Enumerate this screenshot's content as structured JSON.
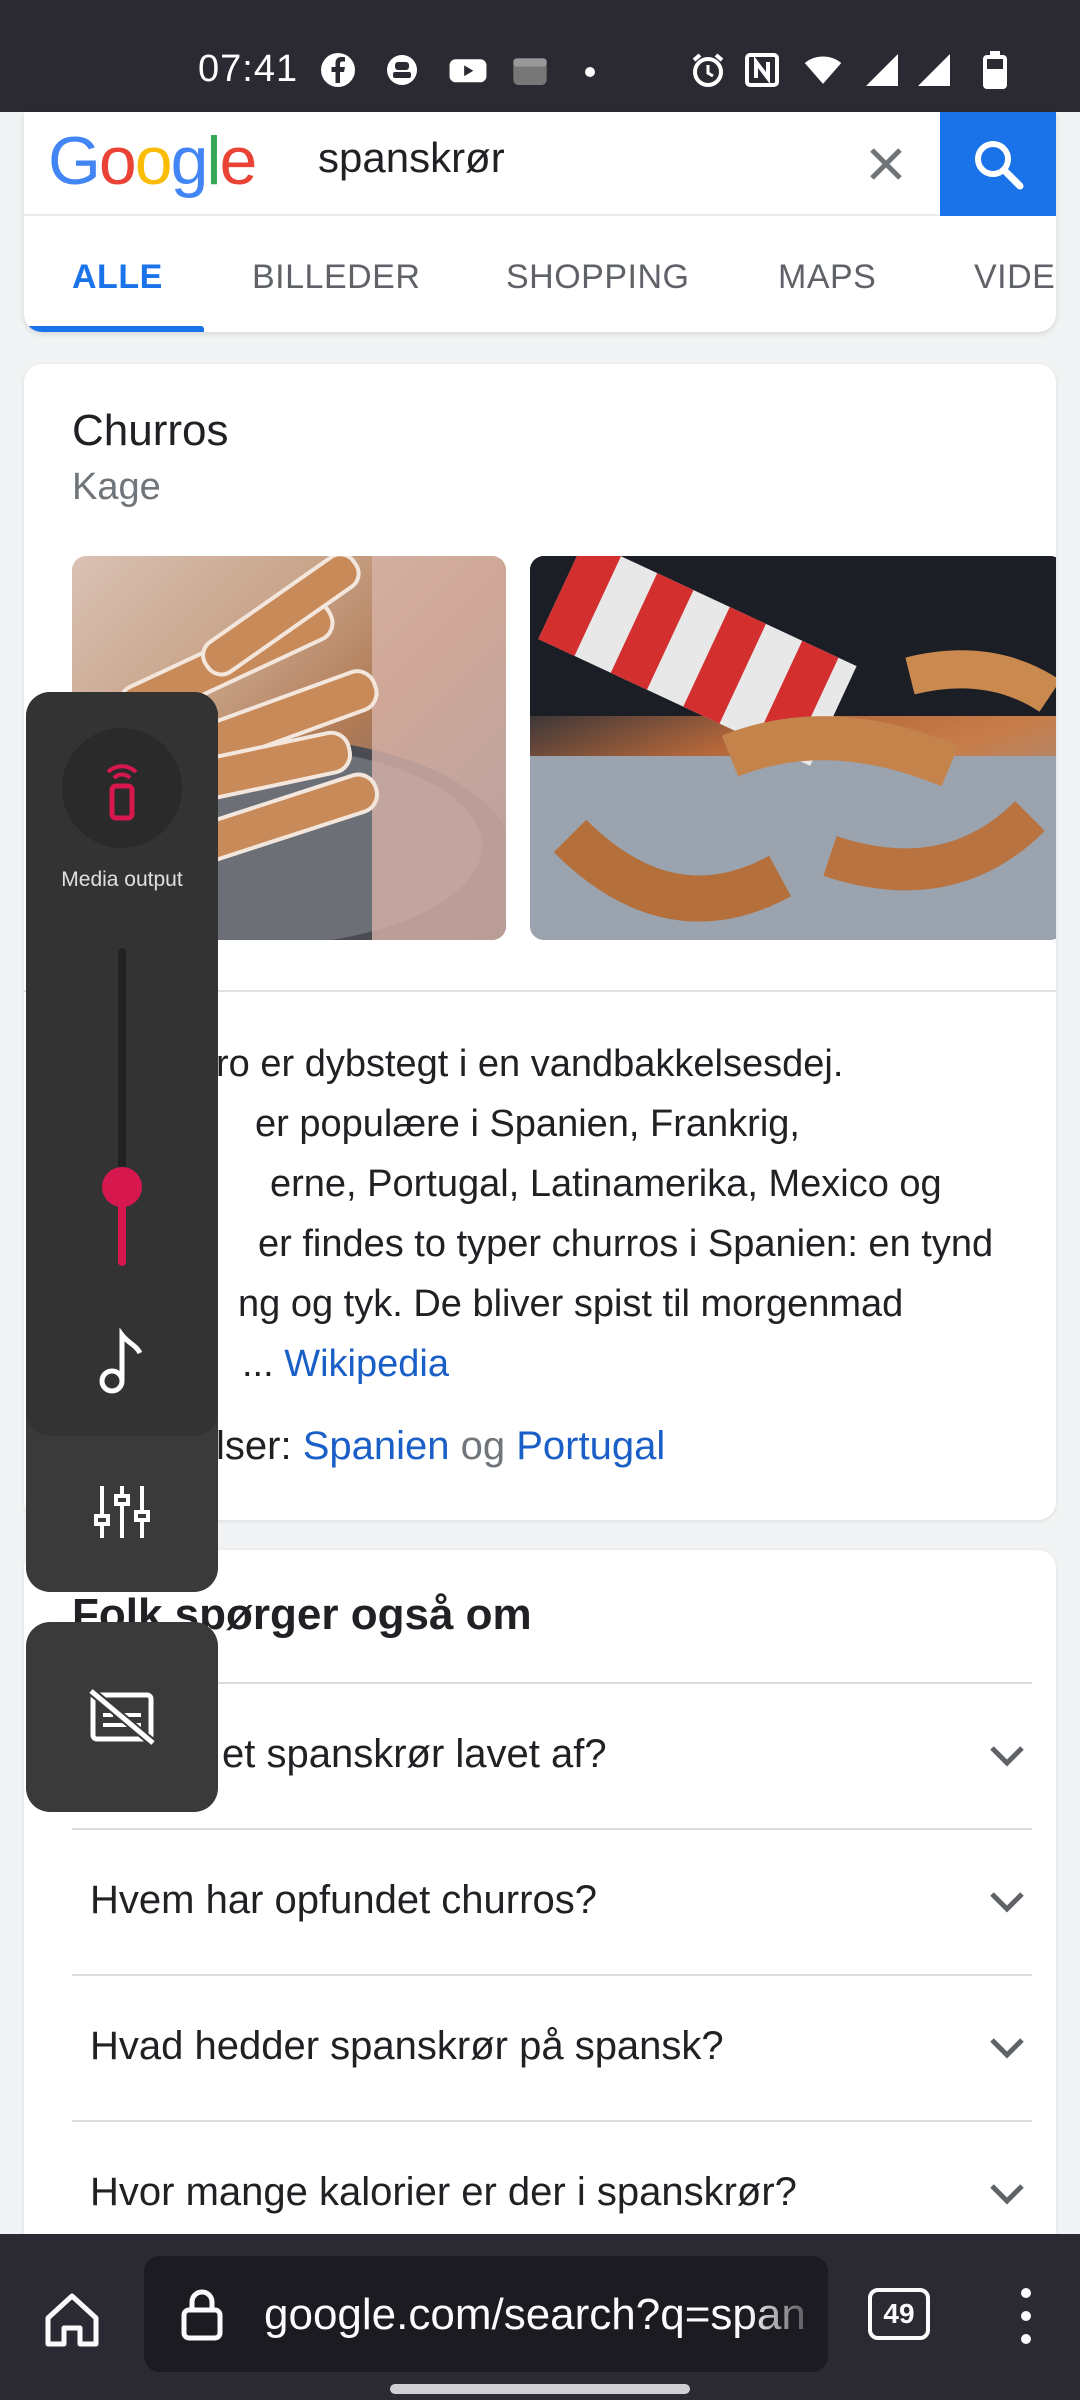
{
  "status_bar": {
    "time": "07:41"
  },
  "search": {
    "query": "spanskrør",
    "logo_letters": [
      "G",
      "o",
      "o",
      "g",
      "l",
      "e"
    ],
    "logo_colors": [
      "#4285F4",
      "#EA4335",
      "#FBBC05",
      "#4285F4",
      "#34A853",
      "#EA4335"
    ]
  },
  "tabs": [
    {
      "label": "ALLE",
      "active": true
    },
    {
      "label": "BILLEDER",
      "active": false
    },
    {
      "label": "SHOPPING",
      "active": false
    },
    {
      "label": "MAPS",
      "active": false
    },
    {
      "label": "VIDEO",
      "active": false
    }
  ],
  "knowledge_panel": {
    "title": "Churros",
    "subtitle": "Kage",
    "description_lines": [
      "ro er dybstegt i en vandbakkelsesdej.",
      "er populære i Spanien, Frankrig,",
      "erne, Portugal, Latinamerika, Mexico og",
      "er findes to typer churros i Spanien: en tynd",
      "ng og tyk. De bliver spist til morgenmad",
      "..."
    ],
    "wiki_link": "Wikipedia",
    "origin_prefix": "lser:",
    "origin_country_1": "Spanien",
    "origin_joiner": "og",
    "origin_country_2": "Portugal"
  },
  "people_also_ask": {
    "title": "Folk spørger også om",
    "questions": [
      "et spanskrør lavet af?",
      "Hvem har opfundet churros?",
      "Hvad hedder spanskrør på spansk?",
      "Hvor mange kalorier er der i spanskrør?"
    ]
  },
  "volume_panel": {
    "media_output_label": "Media output",
    "level": 0.25,
    "accent_color": "#d6184f"
  },
  "browser_bar": {
    "url": "google.com/search?q=span",
    "tab_count": "49"
  }
}
